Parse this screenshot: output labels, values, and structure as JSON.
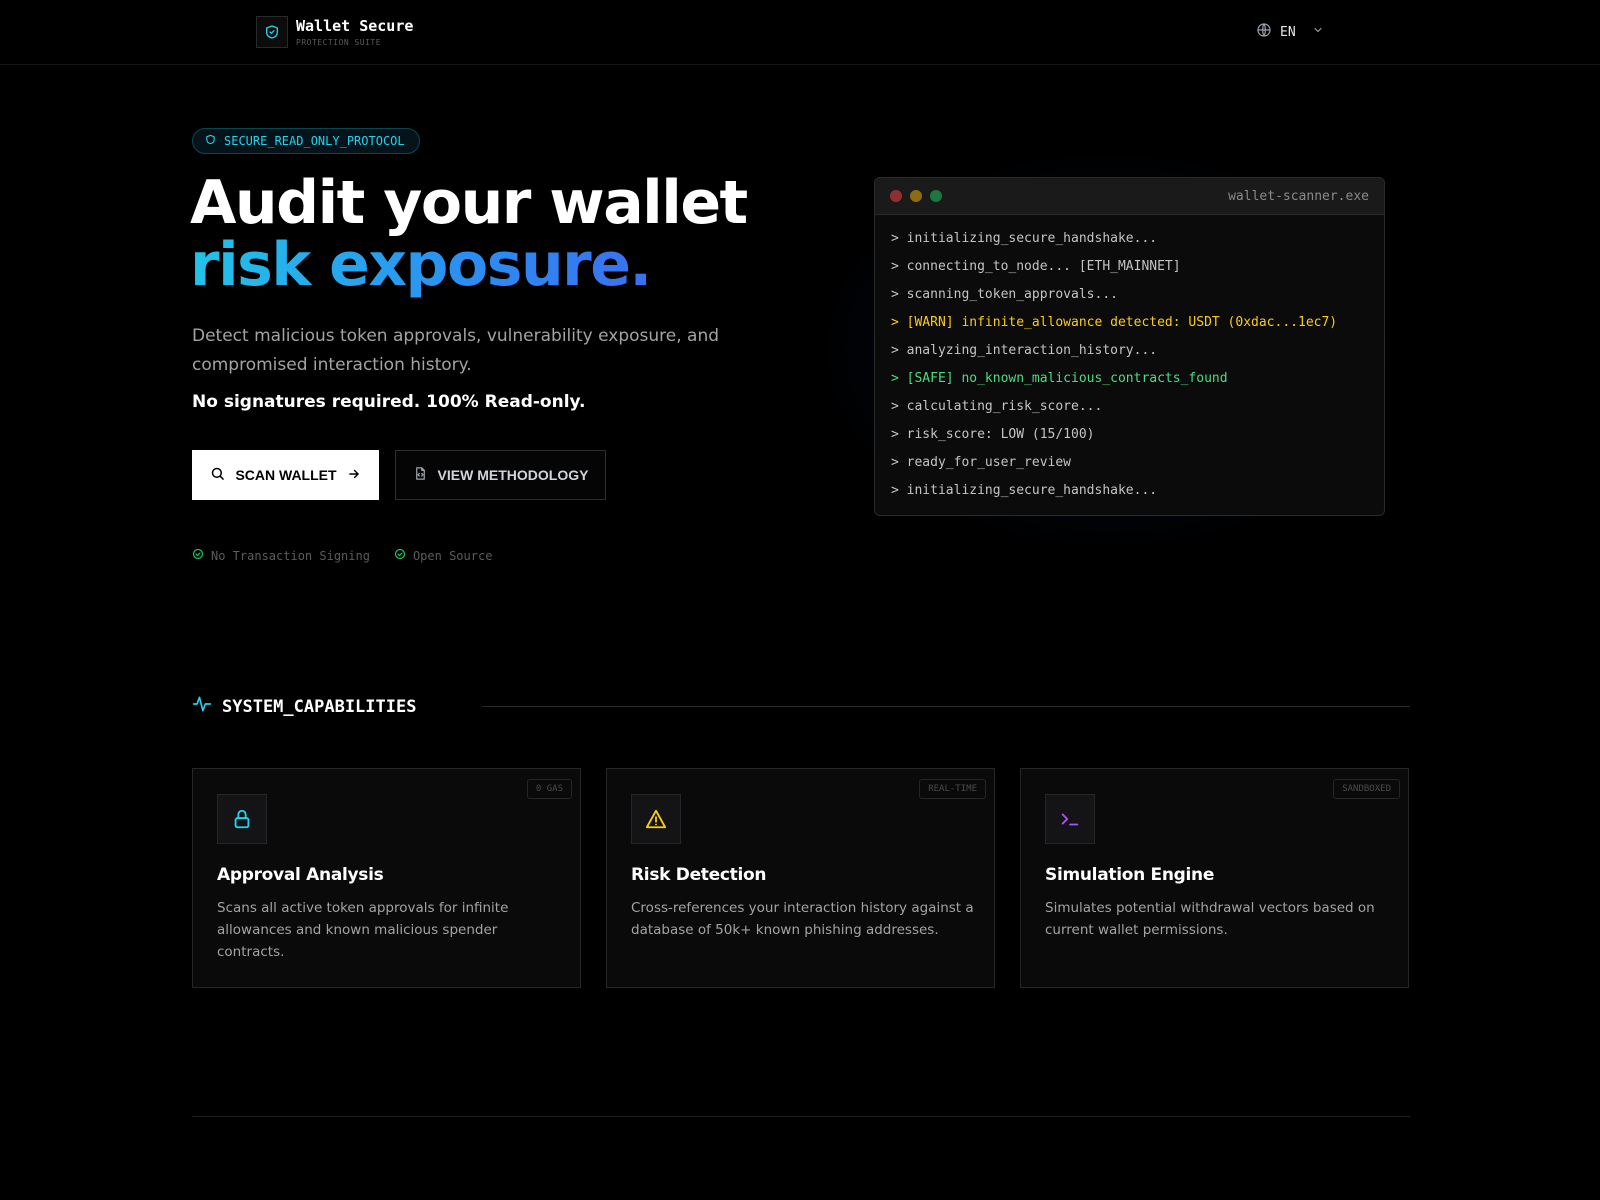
{
  "header": {
    "brand_name": "Wallet Secure",
    "brand_sub": "PROTECTION SUITE",
    "logo_icon": "shield-check-icon",
    "language": "EN"
  },
  "hero": {
    "badge": "SECURE_READ_ONLY_PROTOCOL",
    "title_line1": "Audit your wallet",
    "title_line2": "risk exposure.",
    "description": "Detect malicious token approvals, vulnerability exposure, and compromised interaction history.",
    "note": "No signatures required. 100% Read-only.",
    "primary_button": "SCAN WALLET",
    "secondary_button": "VIEW METHODOLOGY",
    "checks": [
      "No Transaction Signing",
      "Open Source"
    ]
  },
  "terminal": {
    "title": "wallet-scanner.exe",
    "lines": [
      {
        "text": "> initializing_secure_handshake...",
        "kind": "normal"
      },
      {
        "text": "> connecting_to_node... [ETH_MAINNET]",
        "kind": "normal"
      },
      {
        "text": "> scanning_token_approvals...",
        "kind": "normal"
      },
      {
        "text": "> [WARN] infinite_allowance detected: USDT (0xdac...1ec7)",
        "kind": "warn"
      },
      {
        "text": "> analyzing_interaction_history...",
        "kind": "normal"
      },
      {
        "text": "> [SAFE] no_known_malicious_contracts_found",
        "kind": "safe"
      },
      {
        "text": "> calculating_risk_score...",
        "kind": "normal"
      },
      {
        "text": "> risk_score: LOW (15/100)",
        "kind": "normal"
      },
      {
        "text": "> ready_for_user_review",
        "kind": "normal"
      },
      {
        "text": "> initializing_secure_handshake...",
        "kind": "normal"
      }
    ]
  },
  "capabilities": {
    "heading": "SYSTEM_CAPABILITIES",
    "cards": [
      {
        "tag": "0 GAS",
        "icon": "lock-icon",
        "title": "Approval Analysis",
        "description": "Scans all active token approvals for infinite allowances and known malicious spender contracts."
      },
      {
        "tag": "REAL-TIME",
        "icon": "warning-triangle-icon",
        "title": "Risk Detection",
        "description": "Cross-references your interaction history against a database of 50k+ known phishing addresses."
      },
      {
        "tag": "SANDBOXED",
        "icon": "terminal-prompt-icon",
        "title": "Simulation Engine",
        "description": "Simulates potential withdrawal vectors based on current wallet permissions."
      }
    ]
  },
  "colors": {
    "accent_cyan": "#22d3ee",
    "warn": "#facc15",
    "safe": "#4ade80",
    "purple": "#a855f7"
  }
}
